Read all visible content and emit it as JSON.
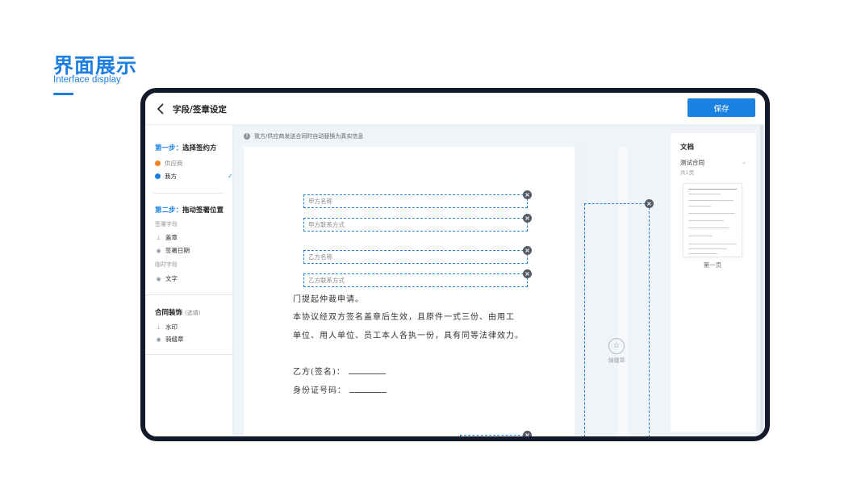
{
  "hero": {
    "title": "界面展示",
    "subtitle": "Interface display"
  },
  "header": {
    "title": "字段/签章设定",
    "save_label": "保存"
  },
  "sidebar": {
    "step1": {
      "prefix": "第一步：",
      "text": "选择签约方"
    },
    "parties": [
      {
        "label": "供应商",
        "color": "#f0841e",
        "active": false
      },
      {
        "label": "我方",
        "color": "#1a82e0",
        "active": true
      }
    ],
    "check": "✓",
    "step2": {
      "prefix": "第二步：",
      "text": "拖动签署位置"
    },
    "sign_fields_label": "签署字段",
    "sign_fields": [
      "盖章",
      "签署日期"
    ],
    "temp_fields_label": "临时字段",
    "temp_fields": [
      "文字"
    ],
    "decoration": {
      "title": "合同装饰",
      "hint": "(选填)"
    },
    "decorations": [
      "水印",
      "骑缝章"
    ]
  },
  "notice": "我方/供应商发送合同时自动替换为真实信息",
  "document": {
    "fields": [
      "甲方名称",
      "甲方联系方式",
      "乙方名称",
      "乙方联系方式"
    ],
    "lines": [
      "门提起仲裁申请。",
      "本协议经双方签名盖章后生效，且原件一式三份、由用工",
      "单位、用人单位、员工本人各执一份，具有同等法律效力。"
    ],
    "sign_name": "乙方(签名)：",
    "sign_id": "身份证号码："
  },
  "seam": {
    "label": "骑缝章"
  },
  "right_panel": {
    "title": "文档",
    "doc_name": "测试合同",
    "pages": "共1页",
    "page_label": "第一页"
  },
  "colors": {
    "accent": "#1a82e0",
    "supplier": "#f0841e",
    "frame": "#121a2b"
  }
}
